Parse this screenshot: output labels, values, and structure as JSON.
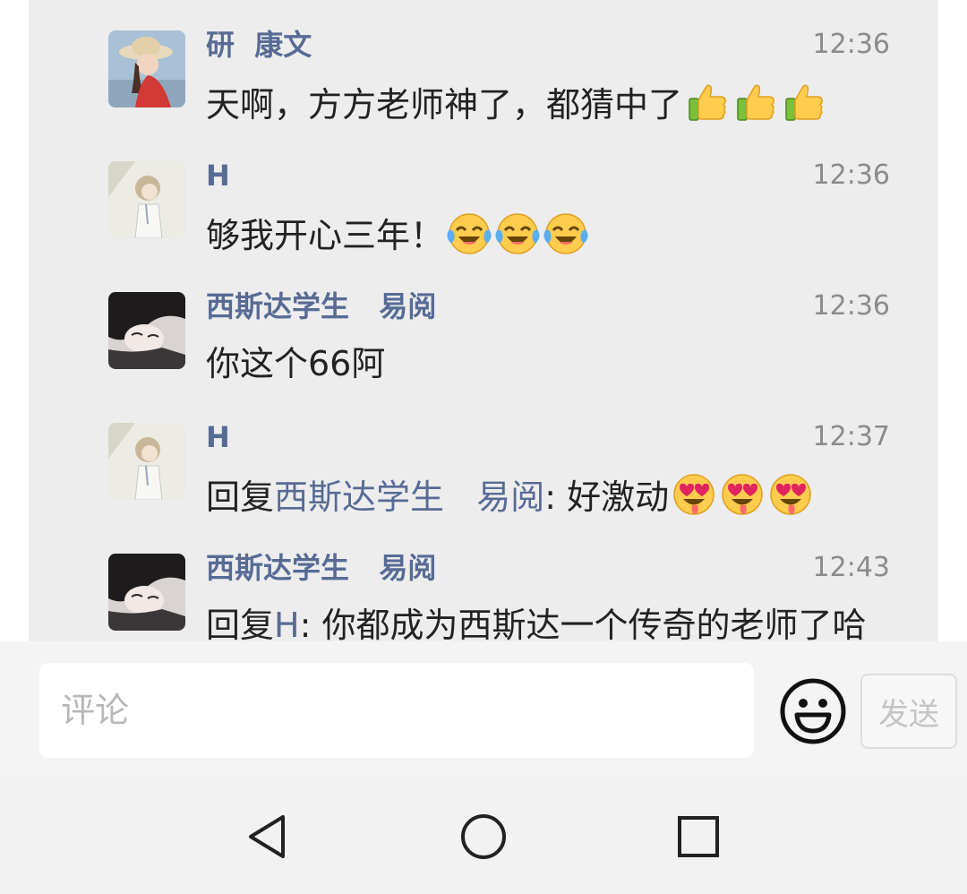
{
  "comments": [
    {
      "name": "研  康文",
      "time": "12:36",
      "text": "天啊，方方老师神了，都猜中了",
      "emoji_icon": "thumbs-up-icon",
      "emoji_count": 3
    },
    {
      "name": "H",
      "time": "12:36",
      "text": "够我开心三年！",
      "emoji_icon": "face-with-tears-of-joy-icon",
      "emoji_count": 3
    },
    {
      "name": "西斯达学生   易阅",
      "time": "12:36",
      "text": "你这个66阿"
    },
    {
      "name": "H",
      "time": "12:37",
      "reply_prefix": "回复",
      "reply_to": "西斯达学生   易阅",
      "reply_sep": ": ",
      "text": "好激动",
      "emoji_icon": "heart-eyes-face-icon",
      "emoji_count": 3
    },
    {
      "name": "西斯达学生   易阅",
      "time": "12:43",
      "reply_prefix": "回复",
      "reply_to": "H",
      "reply_sep": ": ",
      "text": "你都成为西斯达一个传奇的老师了哈"
    }
  ],
  "composer": {
    "placeholder": "评论",
    "emoji_button_icon": "smiley-face-icon",
    "send_label": "发送"
  },
  "navbar": {
    "back_icon": "back-triangle-icon",
    "home_icon": "home-circle-icon",
    "recents_icon": "recents-square-icon"
  },
  "colors": {
    "name_link": "#576b95",
    "panel_bg": "#ededed",
    "text": "#222222",
    "timestamp": "#8b8b8b"
  }
}
